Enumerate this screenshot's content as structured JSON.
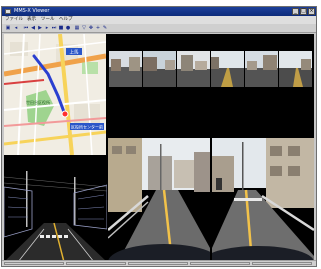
{
  "window": {
    "title": "MMS-X Viewer",
    "controls": {
      "minimize": "_",
      "maximize": "□",
      "close": "×"
    }
  },
  "menu": [
    "ファイル",
    "表示",
    "ツール",
    "ヘルプ"
  ],
  "toolbar": {
    "buttons": [
      {
        "icon": "open-icon",
        "glyph": "▣"
      },
      {
        "icon": "back-icon",
        "glyph": "◂"
      },
      {
        "icon": "rewind-icon",
        "glyph": "⏮"
      },
      {
        "icon": "step-back-icon",
        "glyph": "◀"
      },
      {
        "icon": "play-icon",
        "glyph": "▶"
      },
      {
        "icon": "step-forward-icon",
        "glyph": "▸"
      },
      {
        "icon": "fast-forward-icon",
        "glyph": "⏭"
      },
      {
        "icon": "stop-icon",
        "glyph": "■"
      },
      {
        "icon": "record-icon",
        "glyph": "●"
      },
      {
        "icon": "layout-icon",
        "glyph": "▦"
      },
      {
        "icon": "filter-icon",
        "glyph": "▽"
      },
      {
        "icon": "move-icon",
        "glyph": "✥"
      },
      {
        "icon": "add-icon",
        "glyph": "+"
      },
      {
        "icon": "pen-icon",
        "glyph": "✎"
      }
    ]
  },
  "map": {
    "labels": [
      "上馬",
      "世田谷区役所",
      "区役所センター前"
    ],
    "route_color": "#2a3fd0",
    "vehicle_marker": "vehicle-marker-icon"
  },
  "thumbnails": [
    "camera-1",
    "camera-2",
    "camera-3",
    "camera-4",
    "camera-5",
    "camera-6"
  ],
  "views": {
    "pointcloud": "laser-pointcloud-view",
    "front_left": "front-left-camera-view",
    "front_right": "front-right-camera-view"
  }
}
